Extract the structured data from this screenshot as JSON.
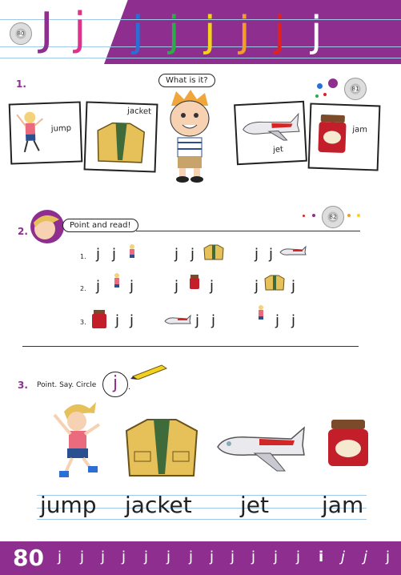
{
  "header": {
    "disc_label": "80",
    "big_letters": [
      "J",
      "j"
    ],
    "band_letters": [
      {
        "ch": "j",
        "color": "#2b6fd6"
      },
      {
        "ch": "j",
        "color": "#2eaa4a"
      },
      {
        "ch": "j",
        "color": "#f2d21a"
      },
      {
        "ch": "j",
        "color": "#f39c2a"
      },
      {
        "ch": "j",
        "color": "#e32020"
      },
      {
        "ch": "j",
        "color": "#ffffff"
      }
    ],
    "colors": {
      "band": "#8e2f8f",
      "big_J": "#8e2f8f",
      "big_j": "#e0318e"
    }
  },
  "section1": {
    "number": "1.",
    "bubble": "What is it?",
    "disc_label": "81",
    "words": {
      "jump": "jump",
      "jacket": "jacket",
      "jet": "jet",
      "jam": "jam"
    }
  },
  "section2": {
    "number": "2.",
    "bubble": "Point and read!",
    "disc_label": "82",
    "row_labels": [
      "1.",
      "2.",
      "3."
    ],
    "letter": "j"
  },
  "section3": {
    "number": "3.",
    "instruction": "Point. Say. Circle",
    "circled_letter": "j",
    "words": [
      "jump",
      "jacket",
      "jet",
      "jam"
    ]
  },
  "footer": {
    "page_number": "80",
    "letters": [
      "j",
      "j",
      "j",
      "j",
      "j",
      "j",
      "j",
      "j",
      "j",
      "j",
      "j",
      "j",
      "i",
      "j",
      "j",
      "j"
    ]
  }
}
